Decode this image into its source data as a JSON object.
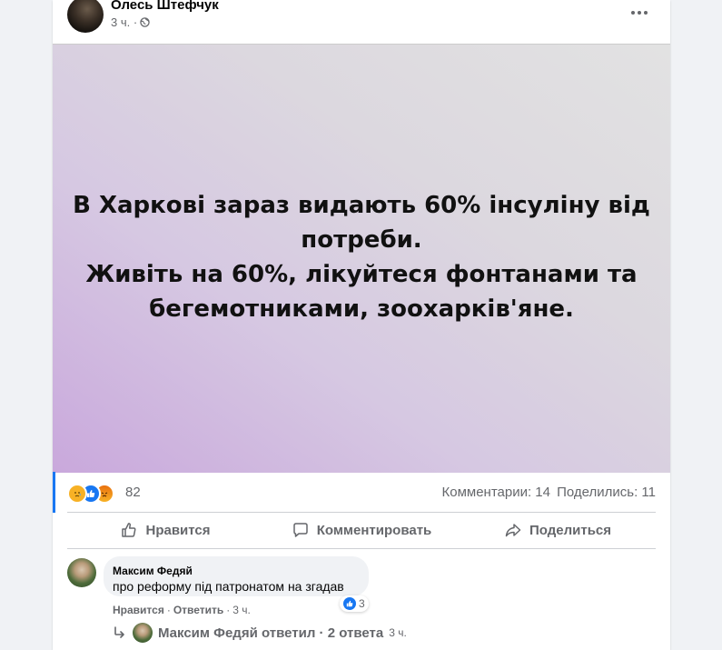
{
  "post": {
    "author": "Олесь Штефчук",
    "time": "3 ч. ·",
    "privacy_icon": "globe-icon",
    "more_icon": "more-options-icon",
    "image_text": [
      "В Харкові зараз видають 60% інсуліну від",
      "потреби.",
      "Живіть на 60%, лікуйтеся фонтанами та",
      "бегемотниками, зоохарків'яне."
    ],
    "reactions": {
      "icons": [
        "sad-icon",
        "like-icon",
        "angry-icon"
      ],
      "count": "82"
    },
    "comments_count": "Комментарии: 14",
    "shares_count": "Поделились: 11"
  },
  "actions": {
    "like_label": "Нравится",
    "comment_label": "Комментировать",
    "share_label": "Поделиться"
  },
  "comment": {
    "author": "Максим Федяй",
    "text": "про реформу під патронатом на згадав",
    "reaction_count": "3",
    "like_link": "Нравится",
    "reply_link": "Ответить",
    "separator": "·",
    "time": "3 ч."
  },
  "replies": {
    "text": "Максим Федяй ответил · 2 ответа",
    "time": "3 ч."
  },
  "colors": {
    "accent": "#1877f2",
    "secondary_text": "#65676b",
    "background": "#f0f2f5"
  }
}
